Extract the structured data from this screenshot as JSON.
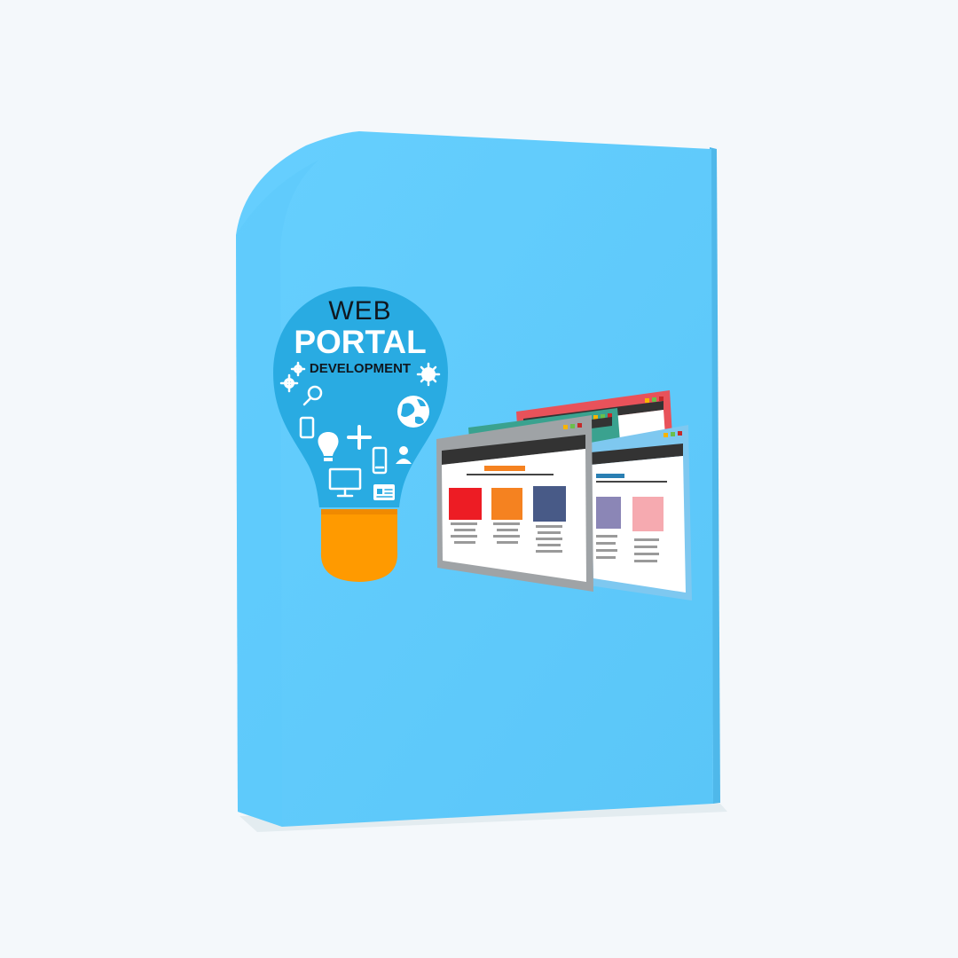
{
  "box": {
    "face_color": "#61ccfd",
    "side_color": "#4fb8ea"
  },
  "bulb": {
    "line1": "WEB",
    "line2": "PORTAL",
    "line3": "DEVELOPMENT",
    "glass_color": "#29abe2",
    "base_color": "#ff9a00",
    "icons": [
      "gears-icon",
      "search-icon",
      "cloud-icon",
      "globe-icon",
      "gear-icon",
      "tablet-icon",
      "plus-icon",
      "lightbulb-icon",
      "phone-icon",
      "user-icon",
      "monitor-icon",
      "id-card-icon"
    ]
  },
  "browsers": {
    "windows": [
      {
        "name": "red-browser-window",
        "frame_color": "#e8525a"
      },
      {
        "name": "teal-browser-window",
        "frame_color": "#3aa28f"
      },
      {
        "name": "blue-browser-window",
        "frame_color": "#7ec8f0"
      },
      {
        "name": "gray-browser-window",
        "frame_color": "#9fa3a6"
      }
    ],
    "front_tiles": [
      "#ed1c24",
      "#f58220",
      "#485a87"
    ],
    "back_tiles": [
      "#8b86b6",
      "#f6aab0"
    ],
    "heading_bar_color": "#f58220",
    "blue_heading_color": "#2a7fb3"
  }
}
